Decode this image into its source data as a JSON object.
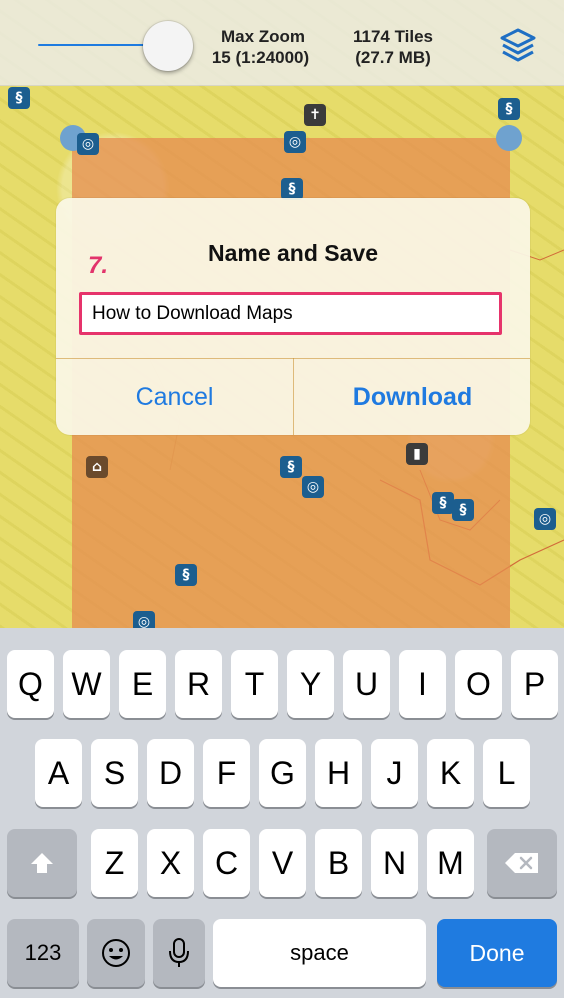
{
  "topbar": {
    "zoom_label": "Max Zoom",
    "zoom_value": "15 (1:24000)",
    "tiles_label": "1174 Tiles",
    "tiles_size": "(27.7 MB)",
    "layers_icon": "layers-icon"
  },
  "map": {
    "region_color": "#e38c55",
    "map_color": "#e6dc6a"
  },
  "dialog": {
    "title": "Name and Save",
    "step_label": "7.",
    "input_value": "How to Download Maps",
    "cancel_label": "Cancel",
    "download_label": "Download"
  },
  "keyboard": {
    "row1": [
      "Q",
      "W",
      "E",
      "R",
      "T",
      "Y",
      "U",
      "I",
      "O",
      "P"
    ],
    "row2": [
      "A",
      "S",
      "D",
      "F",
      "G",
      "H",
      "J",
      "K",
      "L"
    ],
    "row3": [
      "Z",
      "X",
      "C",
      "V",
      "B",
      "N",
      "M"
    ],
    "numbers_label": "123",
    "space_label": "space",
    "done_label": "Done",
    "shift_icon": "shift-icon",
    "delete_icon": "delete-icon",
    "emoji_icon": "emoji-icon",
    "mic_icon": "microphone-icon",
    "accent_color": "#1f7be0"
  }
}
